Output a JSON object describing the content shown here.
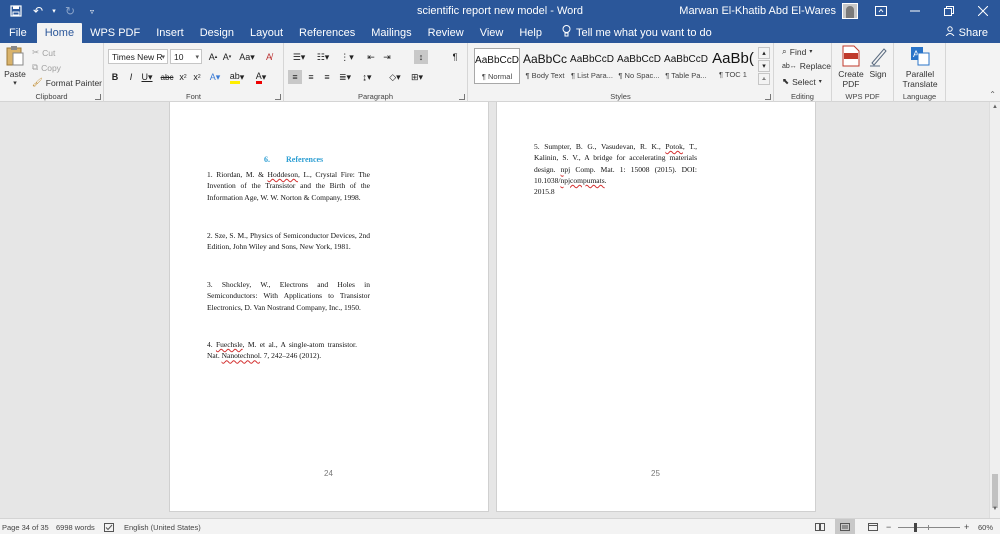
{
  "window": {
    "title": "scientific report new model  -  Word",
    "user_name": "Marwan El-Khatib Abd El-Wares"
  },
  "tabs": [
    {
      "label": "File"
    },
    {
      "label": "Home"
    },
    {
      "label": "WPS PDF"
    },
    {
      "label": "Insert"
    },
    {
      "label": "Design"
    },
    {
      "label": "Layout"
    },
    {
      "label": "References"
    },
    {
      "label": "Mailings"
    },
    {
      "label": "Review"
    },
    {
      "label": "View"
    },
    {
      "label": "Help"
    }
  ],
  "tell_me": "Tell me what you want to do",
  "share_label": "Share",
  "ribbon": {
    "clipboard": {
      "label": "Clipboard",
      "paste": "Paste",
      "cut": "Cut",
      "copy": "Copy",
      "format_painter": "Format Painter"
    },
    "font": {
      "label": "Font",
      "font_name": "Times New R",
      "font_size": "10"
    },
    "paragraph": {
      "label": "Paragraph"
    },
    "styles": {
      "label": "Styles",
      "items": [
        {
          "sample": "AaBbCcD",
          "name": "¶ Normal"
        },
        {
          "sample": "AaBbCc",
          "name": "¶ Body Text"
        },
        {
          "sample": "AaBbCcD",
          "name": "¶ List Para..."
        },
        {
          "sample": "AaBbCcD",
          "name": "¶ No Spac..."
        },
        {
          "sample": "AaBbCcD",
          "name": "¶ Table Pa..."
        },
        {
          "sample": "AaBb(",
          "name": "¶ TOC 1"
        }
      ]
    },
    "editing": {
      "label": "Editing",
      "find": "Find",
      "replace": "Replace",
      "select": "Select"
    },
    "wps_pdf": {
      "label": "WPS PDF",
      "create_line1": "Create",
      "create_line2": "PDF",
      "sign": "Sign"
    },
    "language": {
      "label": "Language",
      "parallel_line1": "Parallel",
      "parallel_line2": "Translate"
    }
  },
  "document": {
    "page_left": {
      "number": "24",
      "heading_number": "6.",
      "heading": "References",
      "ref1": {
        "num": "1. ",
        "author_a": "Riordan, M. & ",
        "author_b": "Hoddeson",
        "rest": ", L., Crystal Fire: The Invention of the Transistor and the Birth of the Information Age, W. W. Norton & Company, 1998."
      },
      "ref2": "2. Sze, S. M., Physics of Semiconductor Devices, 2nd Edition, John Wiley and Sons, New York, 1981.",
      "ref3": "3. Shockley, W., Electrons and Holes in Semiconductors: With Applications to Transistor Electronics, D. Van Nostrand Company, Inc., 1950.",
      "ref4": {
        "num": "4. ",
        "author": "Fuechsle",
        "mid": ", M. et al., A single-atom transistor. Nat. ",
        "journal": "Nanotechnol",
        "rest": ". 7, 242–246 (2012)."
      }
    },
    "page_right": {
      "number": "25",
      "ref5": {
        "a": "5. Sumpter, B. G., Vasudevan, R. K., ",
        "b": "Potok",
        "c": ", T., Kalinin, S. V., A bridge for accelerating materials design. ",
        "d": "npj",
        "e": " Comp. Mat. 1: 15008 (2015). DOI: 10.1038/",
        "f": "npjcompumats",
        "g": ".",
        "h": "2015.8"
      }
    }
  },
  "status": {
    "page": "Page 34 of 35",
    "words": "6998 words",
    "language": "English (United States)",
    "zoom": "60%"
  }
}
